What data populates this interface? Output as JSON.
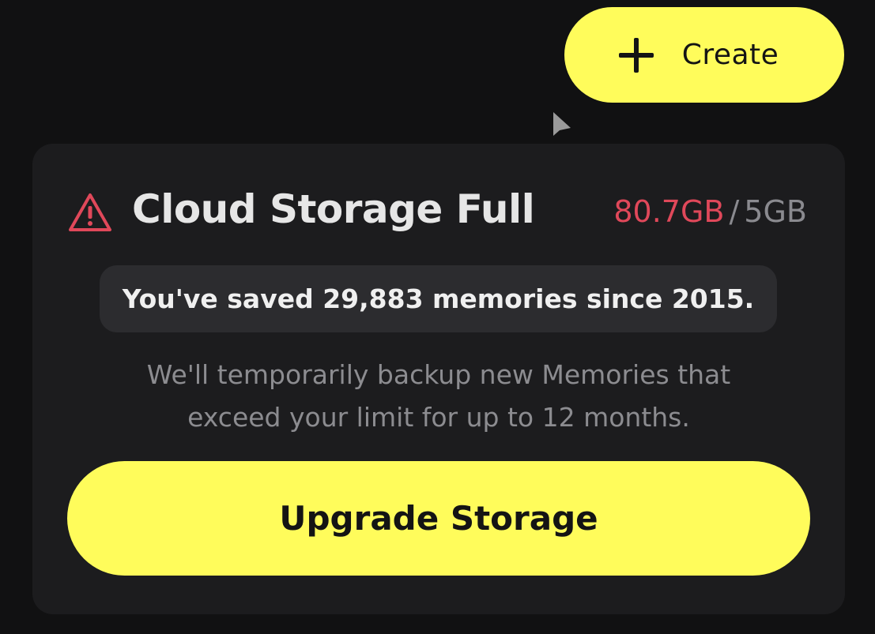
{
  "header": {
    "create_button": {
      "label": "Create",
      "icon": "plus-icon"
    }
  },
  "storage_card": {
    "title": "Cloud Storage Full",
    "warning_icon": "warning-triangle-icon",
    "used": "80.7GB",
    "separator": "/",
    "limit": "5GB",
    "memories_summary": "You've saved 29,883 memories since 2015.",
    "note_line1": "We'll temporarily backup new Memories that",
    "note_line2": "exceed your limit for up to 12 months.",
    "upgrade_button_label": "Upgrade Storage"
  },
  "colors": {
    "accent_yellow": "#fffc5b",
    "warning_red": "#e0485a",
    "card_bg": "#1c1c1e",
    "page_bg": "#111112"
  }
}
